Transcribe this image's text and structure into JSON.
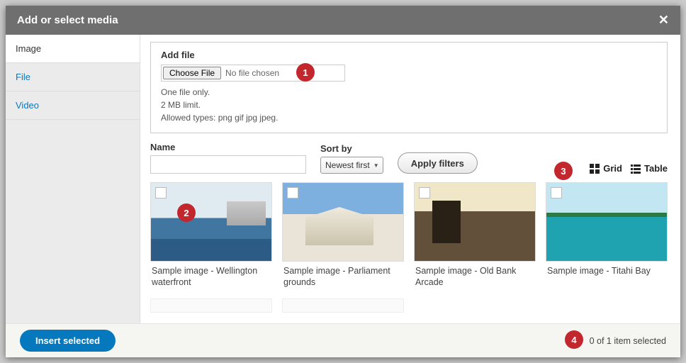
{
  "header": {
    "title": "Add or select media"
  },
  "sidebar": {
    "tabs": [
      {
        "label": "Image",
        "active": true
      },
      {
        "label": "File",
        "active": false
      },
      {
        "label": "Video",
        "active": false
      }
    ]
  },
  "upload": {
    "label": "Add file",
    "choose_button": "Choose File",
    "status": "No file chosen",
    "hint_line1": "One file only.",
    "hint_line2": "2 MB limit.",
    "hint_line3": "Allowed types: png gif jpg jpeg."
  },
  "filters": {
    "name_label": "Name",
    "name_value": "",
    "sort_label": "Sort by",
    "sort_value": "Newest first",
    "apply_label": "Apply filters",
    "view_grid_label": "Grid",
    "view_table_label": "Table"
  },
  "items": [
    {
      "caption": "Sample image - Wellington waterfront"
    },
    {
      "caption": "Sample image - Parliament grounds"
    },
    {
      "caption": "Sample image - Old Bank Arcade"
    },
    {
      "caption": "Sample image - Titahi Bay"
    }
  ],
  "footer": {
    "insert_label": "Insert selected",
    "selection_text": "0 of 1 item selected"
  },
  "annotations": {
    "1": "1",
    "2": "2",
    "3": "3",
    "4": "4"
  }
}
